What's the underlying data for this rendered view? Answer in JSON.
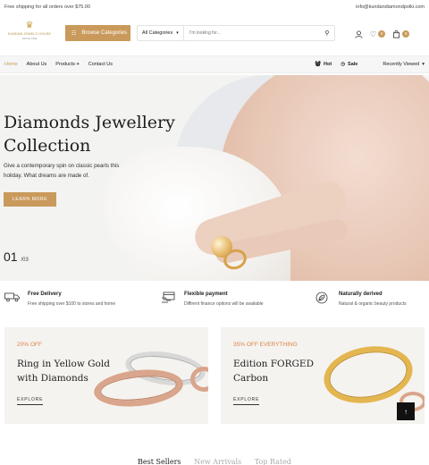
{
  "topbar": {
    "shipping_text": "Free shipping for all orders over $75.00",
    "email": "info@kundandiamondpolki.com"
  },
  "header": {
    "logo_name": "KUNDAN JEWELS HOUSE",
    "logo_since": "SINCE 1998",
    "browse_label": "Browse Categories",
    "category_select": "All Categories",
    "search_placeholder": "I'm looking for...",
    "wishlist_count": "0",
    "cart_count": "0"
  },
  "nav": {
    "links": [
      "Home",
      "About Us",
      "Products",
      "Contact Us"
    ],
    "hot_label": "Hot",
    "sale_label": "Sale",
    "recent_label": "Recently Viewed"
  },
  "hero": {
    "title": "Diamonds Jewellery Collection",
    "subtitle": "Give a contemporary spin on classic pearls this holiday. What dreams are made of.",
    "button": "LEARN MORE",
    "slide_current": "01",
    "slide_total": "/03"
  },
  "features": [
    {
      "title": "Free Delivery",
      "desc": "Free shipping over $100 to stores and home",
      "icon": "truck-icon"
    },
    {
      "title": "Flexible payment",
      "desc": "Diffirent finance opitons will be available",
      "icon": "payment-icon"
    },
    {
      "title": "Naturally derived",
      "desc": "Natural & organic beauty products",
      "icon": "leaf-icon"
    }
  ],
  "promos": [
    {
      "tag": "20% OFF",
      "title": "Ring in Yellow Gold with Diamonds",
      "cta": "EXPLORE"
    },
    {
      "tag": "35% OFF EVERYTHING",
      "title": "Edition FORGED Carbon",
      "cta": "EXPLORE"
    }
  ],
  "bottom_tabs": [
    "Best Sellers",
    "New Arrivals",
    "Top Rated"
  ],
  "colors": {
    "accent": "#c99a5b",
    "tag": "#d9824a"
  }
}
